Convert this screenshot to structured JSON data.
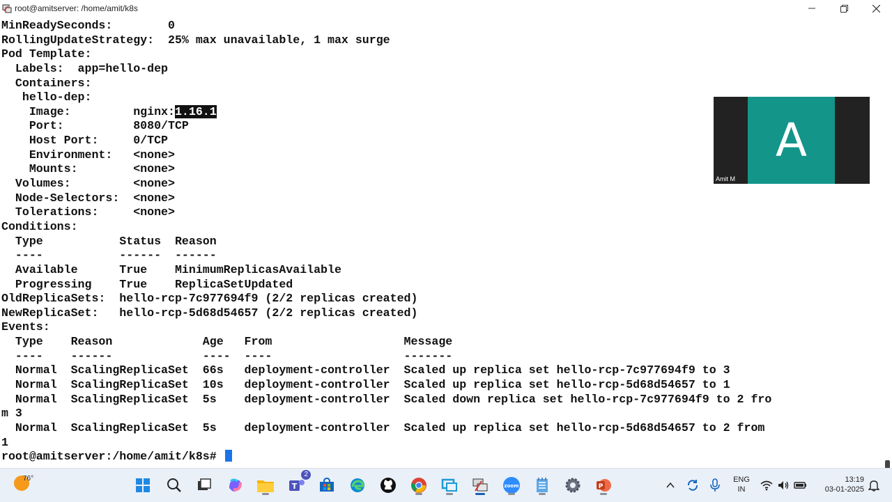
{
  "window": {
    "title": "root@amitserver: /home/amit/k8s",
    "minimize_icon": "minimize-icon",
    "maximize_icon": "maximize-icon",
    "close_icon": "close-icon"
  },
  "terminal": {
    "lines": [
      "MinReadySeconds:        0",
      "RollingUpdateStrategy:  25% max unavailable, 1 max surge",
      "Pod Template:",
      "  Labels:  app=hello-dep",
      "  Containers:",
      "   hello-dep:"
    ],
    "image_label": "    Image:         nginx:",
    "image_version": "1.16.1",
    "lines_after": [
      "    Port:          8080/TCP",
      "    Host Port:     0/TCP",
      "    Environment:   <none>",
      "    Mounts:        <none>",
      "  Volumes:         <none>",
      "  Node-Selectors:  <none>",
      "  Tolerations:     <none>",
      "Conditions:",
      "  Type           Status  Reason",
      "  ----           ------  ------",
      "  Available      True    MinimumReplicasAvailable",
      "  Progressing    True    ReplicaSetUpdated",
      "OldReplicaSets:  hello-rcp-7c977694f9 (2/2 replicas created)",
      "NewReplicaSet:   hello-rcp-5d68d54657 (2/2 replicas created)",
      "Events:",
      "  Type    Reason             Age   From                   Message",
      "  ----    ------             ----  ----                   -------",
      "  Normal  ScalingReplicaSet  66s   deployment-controller  Scaled up replica set hello-rcp-7c977694f9 to 3",
      "  Normal  ScalingReplicaSet  10s   deployment-controller  Scaled up replica set hello-rcp-5d68d54657 to 1",
      "  Normal  ScalingReplicaSet  5s    deployment-controller  Scaled down replica set hello-rcp-7c977694f9 to 2 fro",
      "m 3",
      "  Normal  ScalingReplicaSet  5s    deployment-controller  Scaled up replica set hello-rcp-5d68d54657 to 2 from",
      "1"
    ],
    "prompt": "root@amitserver:/home/amit/k8s# "
  },
  "video_call": {
    "avatar_letter": "A",
    "participant_name": "Amit M",
    "tile_color": "#13958a"
  },
  "taskbar": {
    "weather_temp": "76°",
    "weather_icon": "sun-icon",
    "apps": [
      "windows-start-icon",
      "search-icon",
      "task-view-icon",
      "copilot-icon",
      "file-explorer-icon",
      "teams-icon",
      "microsoft-store-icon",
      "edge-icon",
      "github-icon",
      "chrome-icon",
      "remote-desktop-icon",
      "putty-icon",
      "zoom-icon",
      "notepad-icon",
      "settings-icon",
      "powerpoint-icon"
    ],
    "teams_badge": "2",
    "lang_primary": "ENG",
    "lang_secondary": "IN",
    "time": "13:19",
    "date": "03-01-2025"
  }
}
